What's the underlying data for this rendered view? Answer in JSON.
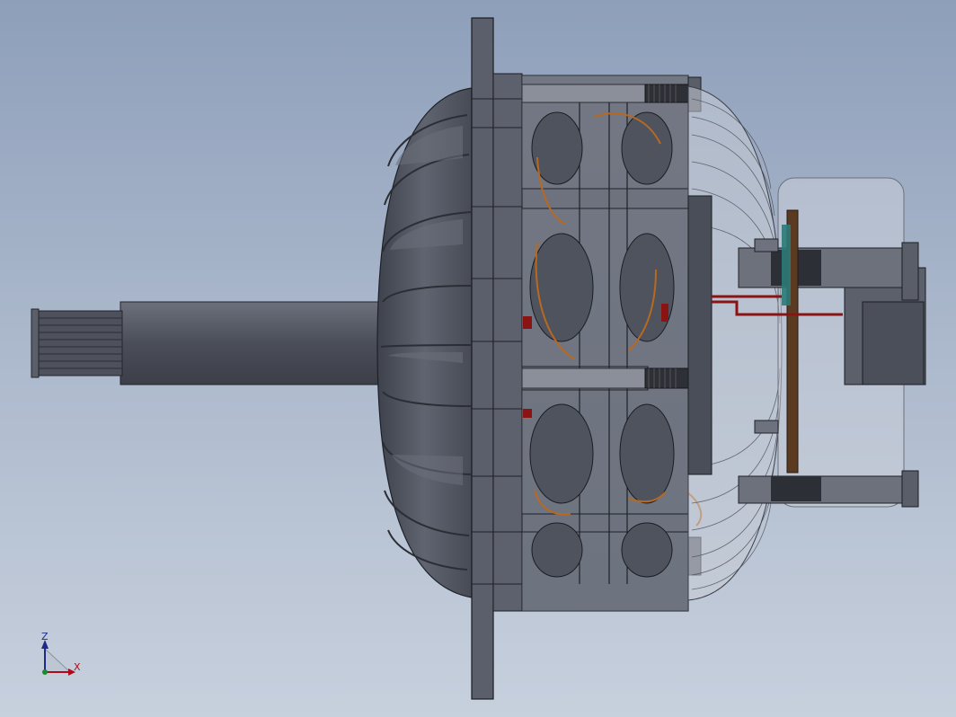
{
  "view": {
    "background_top": "#8e9fba",
    "background_bottom": "#c7d0dd"
  },
  "model": {
    "body_color": "#555a66",
    "body_edge": "#1c1e24",
    "housing_translucent": "#c9cfda",
    "coil_color": "#b8691f",
    "wire_color": "#8a1414",
    "board_color": "#5a3b22",
    "accent_teal": "#2c7a78"
  },
  "triad": {
    "z_label": "Z",
    "x_label": "X",
    "z_color": "#1d2a8c",
    "x_color": "#b00a1a",
    "y_color": "#1a8a2a"
  }
}
